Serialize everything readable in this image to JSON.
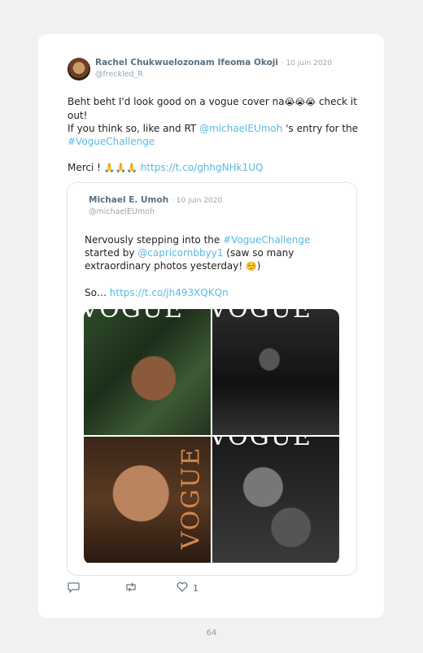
{
  "tweet": {
    "author_name": "Rachel Chukwuelozonam Ifeoma Okoji",
    "separator": "·",
    "date": "10 juin 2020",
    "handle": "@freckled_R",
    "line1": "Beht beht I'd look good on a vogue cover na",
    "line1_emoji": "😭😭😭",
    "line1_end": " check it out!",
    "line2_start": "If you think so, like and RT ",
    "line2_mention": "@michaelEUmoh",
    "line2_end": " 's entry for the",
    "hashtag": "#VogueChallenge",
    "line4_start": "Merci ! ",
    "line4_emoji": "🙏🙏🙏",
    "line4_link": " https://t.co/ghhgNHk1UQ"
  },
  "quoted": {
    "author_name": "Michael E. Umoh",
    "separator": "·",
    "date": "10 juin 2020",
    "handle": "@michaelEUmoh",
    "l1_start": "Nervously stepping into the ",
    "l1_hashtag": "#VogueChallenge",
    "l2_start": "started by ",
    "l2_mention": "@capricornbbyy1",
    "l2_end": " (saw so many",
    "l3": "extraordinary photos yesterday! ",
    "l3_emoji": "☺️",
    "l4_start": "So… ",
    "l4_link": "https://t.co/jh493XQKQn",
    "photos": [
      {
        "overlay": "VOGUE"
      },
      {
        "overlay": "VOGUE"
      },
      {
        "overlay": "VOGUE"
      },
      {
        "overlay": "VOGUE"
      }
    ]
  },
  "actions": {
    "reply_count": "",
    "retweet_count": "",
    "like_count": "1"
  },
  "page_number": "64",
  "colors": {
    "link": "#5ab8e5",
    "name": "#5a6f80",
    "muted": "#9aa5ad"
  }
}
